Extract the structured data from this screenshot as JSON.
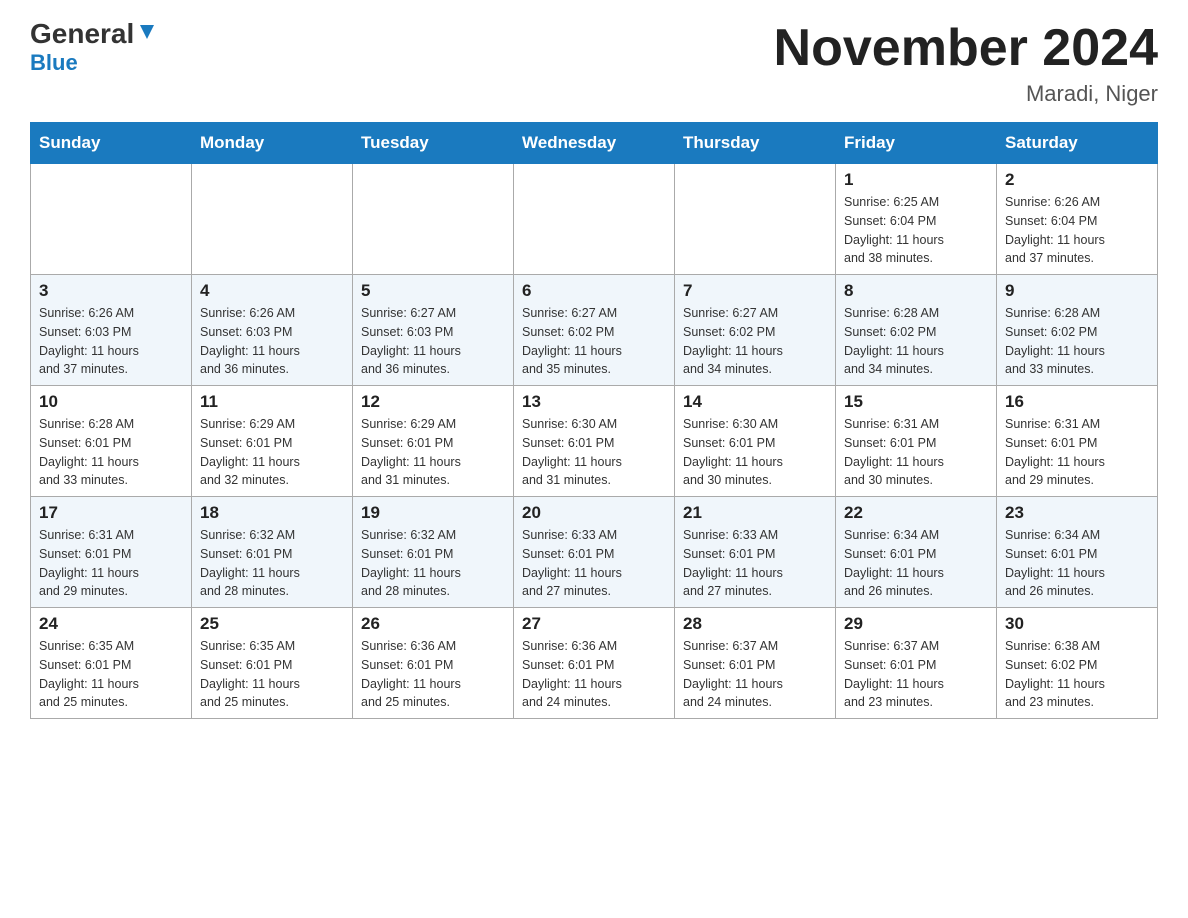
{
  "header": {
    "logo_part1": "General",
    "logo_part2": "Blue",
    "month_title": "November 2024",
    "location": "Maradi, Niger"
  },
  "weekdays": [
    "Sunday",
    "Monday",
    "Tuesday",
    "Wednesday",
    "Thursday",
    "Friday",
    "Saturday"
  ],
  "weeks": [
    {
      "days": [
        {
          "num": "",
          "info": ""
        },
        {
          "num": "",
          "info": ""
        },
        {
          "num": "",
          "info": ""
        },
        {
          "num": "",
          "info": ""
        },
        {
          "num": "",
          "info": ""
        },
        {
          "num": "1",
          "info": "Sunrise: 6:25 AM\nSunset: 6:04 PM\nDaylight: 11 hours\nand 38 minutes."
        },
        {
          "num": "2",
          "info": "Sunrise: 6:26 AM\nSunset: 6:04 PM\nDaylight: 11 hours\nand 37 minutes."
        }
      ]
    },
    {
      "days": [
        {
          "num": "3",
          "info": "Sunrise: 6:26 AM\nSunset: 6:03 PM\nDaylight: 11 hours\nand 37 minutes."
        },
        {
          "num": "4",
          "info": "Sunrise: 6:26 AM\nSunset: 6:03 PM\nDaylight: 11 hours\nand 36 minutes."
        },
        {
          "num": "5",
          "info": "Sunrise: 6:27 AM\nSunset: 6:03 PM\nDaylight: 11 hours\nand 36 minutes."
        },
        {
          "num": "6",
          "info": "Sunrise: 6:27 AM\nSunset: 6:02 PM\nDaylight: 11 hours\nand 35 minutes."
        },
        {
          "num": "7",
          "info": "Sunrise: 6:27 AM\nSunset: 6:02 PM\nDaylight: 11 hours\nand 34 minutes."
        },
        {
          "num": "8",
          "info": "Sunrise: 6:28 AM\nSunset: 6:02 PM\nDaylight: 11 hours\nand 34 minutes."
        },
        {
          "num": "9",
          "info": "Sunrise: 6:28 AM\nSunset: 6:02 PM\nDaylight: 11 hours\nand 33 minutes."
        }
      ]
    },
    {
      "days": [
        {
          "num": "10",
          "info": "Sunrise: 6:28 AM\nSunset: 6:01 PM\nDaylight: 11 hours\nand 33 minutes."
        },
        {
          "num": "11",
          "info": "Sunrise: 6:29 AM\nSunset: 6:01 PM\nDaylight: 11 hours\nand 32 minutes."
        },
        {
          "num": "12",
          "info": "Sunrise: 6:29 AM\nSunset: 6:01 PM\nDaylight: 11 hours\nand 31 minutes."
        },
        {
          "num": "13",
          "info": "Sunrise: 6:30 AM\nSunset: 6:01 PM\nDaylight: 11 hours\nand 31 minutes."
        },
        {
          "num": "14",
          "info": "Sunrise: 6:30 AM\nSunset: 6:01 PM\nDaylight: 11 hours\nand 30 minutes."
        },
        {
          "num": "15",
          "info": "Sunrise: 6:31 AM\nSunset: 6:01 PM\nDaylight: 11 hours\nand 30 minutes."
        },
        {
          "num": "16",
          "info": "Sunrise: 6:31 AM\nSunset: 6:01 PM\nDaylight: 11 hours\nand 29 minutes."
        }
      ]
    },
    {
      "days": [
        {
          "num": "17",
          "info": "Sunrise: 6:31 AM\nSunset: 6:01 PM\nDaylight: 11 hours\nand 29 minutes."
        },
        {
          "num": "18",
          "info": "Sunrise: 6:32 AM\nSunset: 6:01 PM\nDaylight: 11 hours\nand 28 minutes."
        },
        {
          "num": "19",
          "info": "Sunrise: 6:32 AM\nSunset: 6:01 PM\nDaylight: 11 hours\nand 28 minutes."
        },
        {
          "num": "20",
          "info": "Sunrise: 6:33 AM\nSunset: 6:01 PM\nDaylight: 11 hours\nand 27 minutes."
        },
        {
          "num": "21",
          "info": "Sunrise: 6:33 AM\nSunset: 6:01 PM\nDaylight: 11 hours\nand 27 minutes."
        },
        {
          "num": "22",
          "info": "Sunrise: 6:34 AM\nSunset: 6:01 PM\nDaylight: 11 hours\nand 26 minutes."
        },
        {
          "num": "23",
          "info": "Sunrise: 6:34 AM\nSunset: 6:01 PM\nDaylight: 11 hours\nand 26 minutes."
        }
      ]
    },
    {
      "days": [
        {
          "num": "24",
          "info": "Sunrise: 6:35 AM\nSunset: 6:01 PM\nDaylight: 11 hours\nand 25 minutes."
        },
        {
          "num": "25",
          "info": "Sunrise: 6:35 AM\nSunset: 6:01 PM\nDaylight: 11 hours\nand 25 minutes."
        },
        {
          "num": "26",
          "info": "Sunrise: 6:36 AM\nSunset: 6:01 PM\nDaylight: 11 hours\nand 25 minutes."
        },
        {
          "num": "27",
          "info": "Sunrise: 6:36 AM\nSunset: 6:01 PM\nDaylight: 11 hours\nand 24 minutes."
        },
        {
          "num": "28",
          "info": "Sunrise: 6:37 AM\nSunset: 6:01 PM\nDaylight: 11 hours\nand 24 minutes."
        },
        {
          "num": "29",
          "info": "Sunrise: 6:37 AM\nSunset: 6:01 PM\nDaylight: 11 hours\nand 23 minutes."
        },
        {
          "num": "30",
          "info": "Sunrise: 6:38 AM\nSunset: 6:02 PM\nDaylight: 11 hours\nand 23 minutes."
        }
      ]
    }
  ]
}
